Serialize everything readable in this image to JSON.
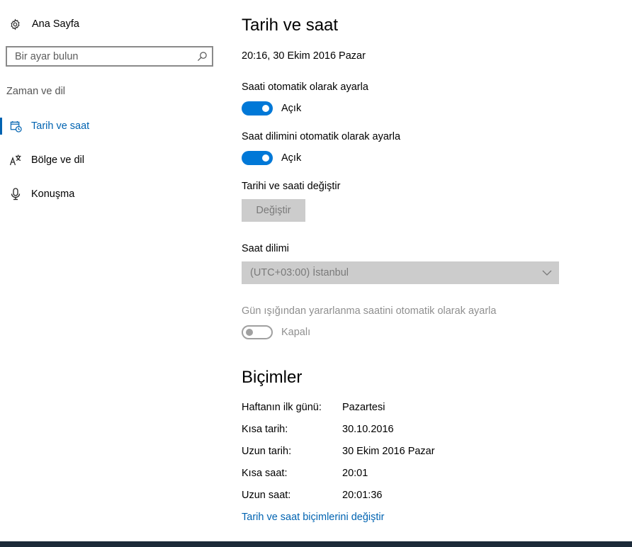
{
  "sidebar": {
    "home_label": "Ana Sayfa",
    "search_placeholder": "Bir ayar bulun",
    "section_label": "Zaman ve dil",
    "items": [
      {
        "label": "Tarih ve saat",
        "icon": "calendar-clock-icon",
        "active": true
      },
      {
        "label": "Bölge ve dil",
        "icon": "language-icon",
        "active": false
      },
      {
        "label": "Konuşma",
        "icon": "microphone-icon",
        "active": false
      }
    ]
  },
  "main": {
    "title": "Tarih ve saat",
    "current_datetime": "20:16, 30 Ekim 2016 Pazar",
    "auto_time": {
      "label": "Saati otomatik olarak ayarla",
      "state": "Açık",
      "on": true
    },
    "auto_timezone": {
      "label": "Saat dilimini otomatik olarak ayarla",
      "state": "Açık",
      "on": true
    },
    "change_datetime": {
      "label": "Tarihi ve saati değiştir",
      "button": "Değiştir"
    },
    "timezone": {
      "label": "Saat dilimi",
      "value": "(UTC+03:00) İstanbul"
    },
    "dst": {
      "label": "Gün ışığından yararlanma saatini otomatik olarak ayarla",
      "state": "Kapalı",
      "on": false
    },
    "formats": {
      "title": "Biçimler",
      "rows": [
        {
          "label": "Haftanın ilk günü:",
          "value": "Pazartesi"
        },
        {
          "label": "Kısa tarih:",
          "value": "30.10.2016"
        },
        {
          "label": "Uzun tarih:",
          "value": "30 Ekim 2016 Pazar"
        },
        {
          "label": "Kısa saat:",
          "value": "20:01"
        },
        {
          "label": "Uzun saat:",
          "value": "20:01:36"
        }
      ],
      "change_link": "Tarih ve saat biçimlerini değiştir"
    }
  },
  "colors": {
    "accent": "#0078d7",
    "link": "#0063b1",
    "disabled_bg": "#cccccc"
  }
}
